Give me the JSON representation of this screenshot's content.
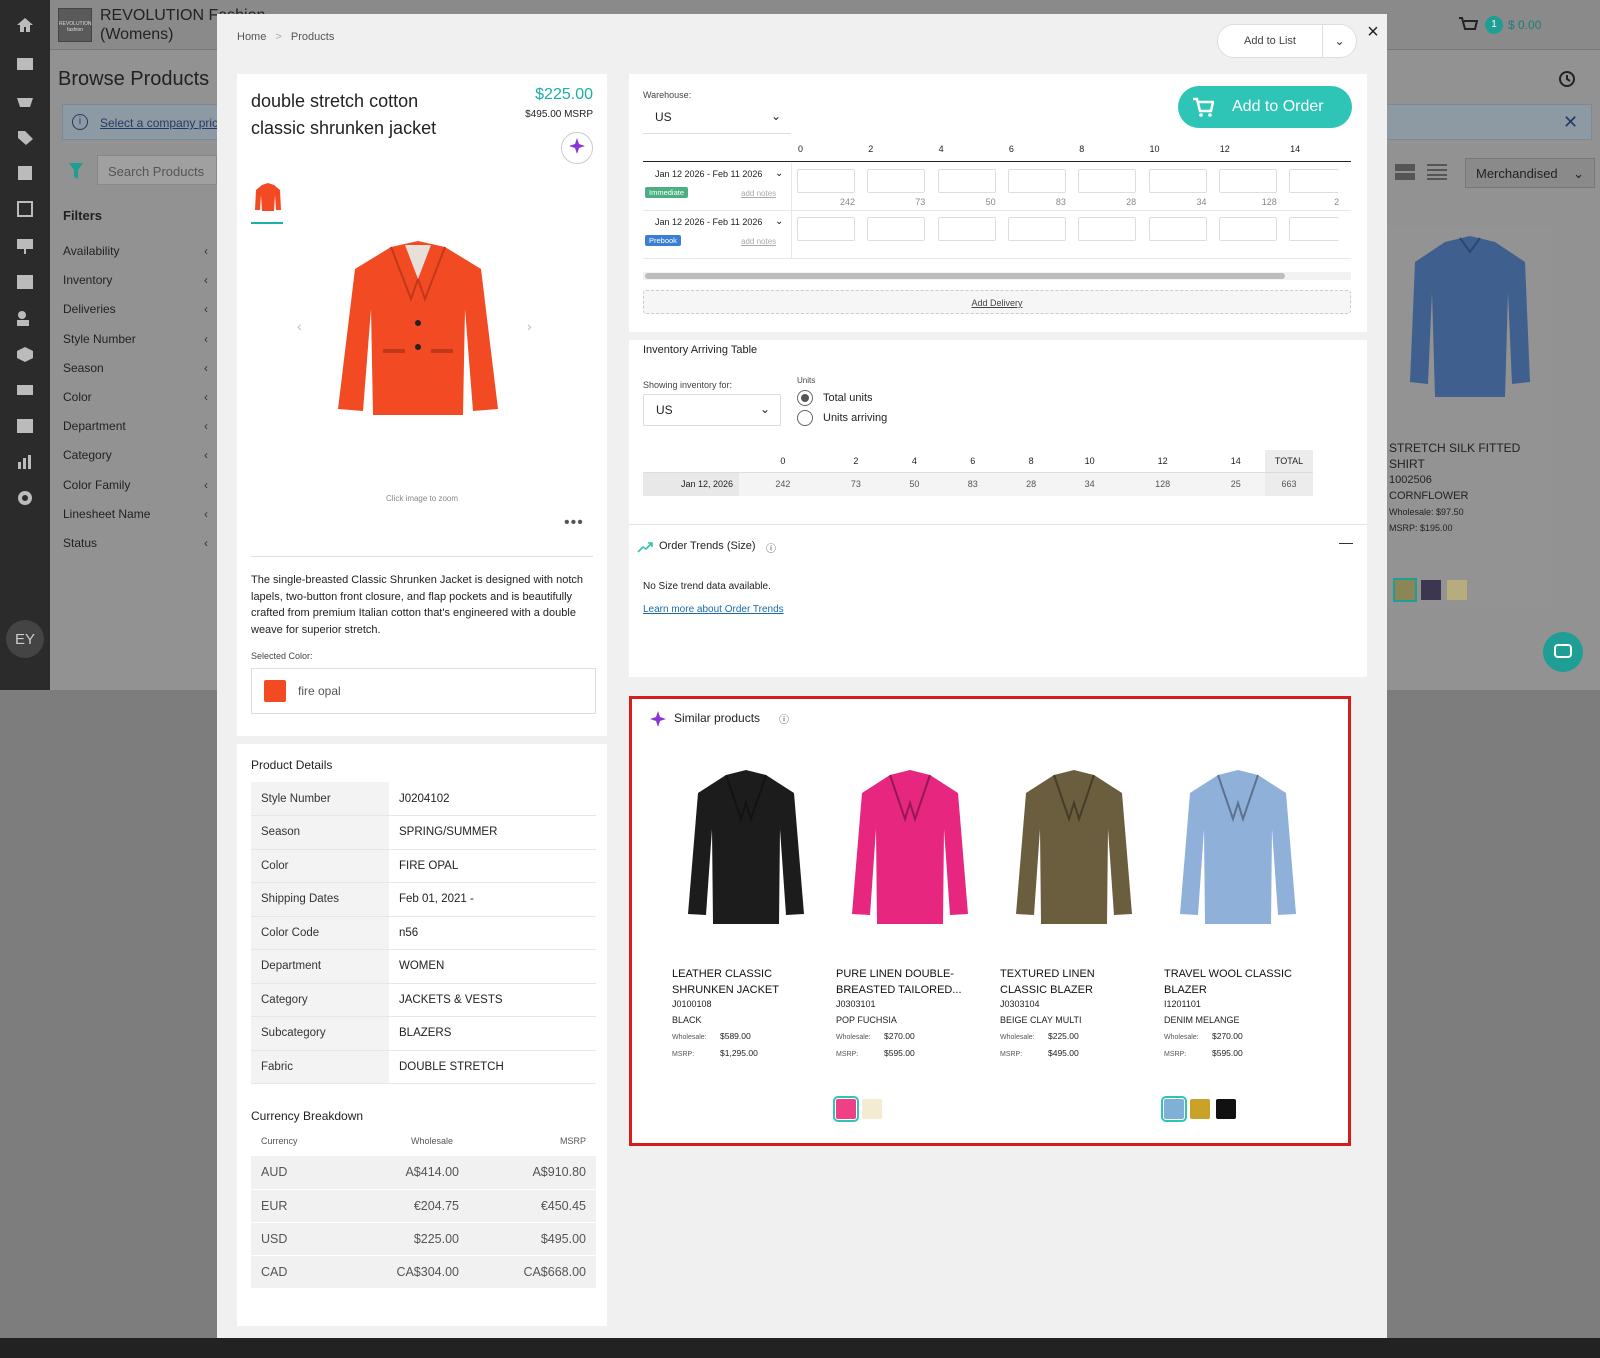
{
  "app": {
    "brand_line1": "REVOLUTION Fashion",
    "brand_line2": "(Womens)",
    "logo_text": "REVOLUTION fashion",
    "browse_title": "Browse Products",
    "company_link": "Select a company pricing",
    "search_placeholder": "Search Products",
    "filters_title": "Filters",
    "filters": [
      "Availability",
      "Inventory",
      "Deliveries",
      "Style Number",
      "Season",
      "Color",
      "Department",
      "Category",
      "Color Family",
      "Linesheet Name",
      "Status"
    ],
    "sort_label": "Merchandised",
    "cart_count": "1",
    "cart_total": "$ 0.00",
    "avatar_initials": "EY",
    "bg_card": {
      "name_line1": "STRETCH SILK FITTED",
      "name_line2": "SHIRT",
      "style": "1002506",
      "color": "CORNFLOWER",
      "wholesale_label": "Wholesale:",
      "wholesale": "$97.50",
      "msrp_label": "MSRP:",
      "msrp": "$195.00"
    }
  },
  "modal": {
    "breadcrumb": [
      "Home",
      "Products"
    ],
    "breadcrumb_sep": ">",
    "add_to_list": "Add to List",
    "close": "×",
    "product": {
      "title": "double stretch cotton classic shrunken jacket",
      "price": "$225.00",
      "msrp": "$495.00 MSRP",
      "zoom_hint": "Click image to zoom",
      "more": "•••",
      "description": "The single-breasted Classic Shrunken Jacket is designed with notch lapels, two-button front closure, and flap pockets and is beautifully crafted from premium Italian cotton that's engineered with a double weave for superior stretch.",
      "selected_color_label": "Selected Color:",
      "selected_color": "fire opal",
      "details_title": "Product Details",
      "details": [
        {
          "k": "Style Number",
          "v": "J0204102"
        },
        {
          "k": "Season",
          "v": "SPRING/SUMMER"
        },
        {
          "k": "Color",
          "v": "FIRE OPAL"
        },
        {
          "k": "Shipping Dates",
          "v": "Feb 01, 2021 -"
        },
        {
          "k": "Color Code",
          "v": "n56"
        },
        {
          "k": "Department",
          "v": "WOMEN"
        },
        {
          "k": "Category",
          "v": "JACKETS & VESTS"
        },
        {
          "k": "Subcategory",
          "v": "BLAZERS"
        },
        {
          "k": "Fabric",
          "v": "DOUBLE STRETCH"
        }
      ],
      "currency_title": "Currency Breakdown",
      "currency_headers": [
        "Currency",
        "Wholesale",
        "MSRP"
      ],
      "currencies": [
        {
          "c": "AUD",
          "w": "A$414.00",
          "m": "A$910.80"
        },
        {
          "c": "EUR",
          "w": "€204.75",
          "m": "€450.45"
        },
        {
          "c": "USD",
          "w": "$225.00",
          "m": "$495.00"
        },
        {
          "c": "CAD",
          "w": "CA$304.00",
          "m": "CA$668.00"
        }
      ]
    },
    "order": {
      "warehouse_label": "Warehouse:",
      "warehouse": "US",
      "add_to_order": "Add to Order",
      "sizes": [
        "0",
        "2",
        "4",
        "6",
        "8",
        "10",
        "12",
        "14"
      ],
      "deliveries": [
        {
          "date": "Jan 12 2026 - Feb 11 2026",
          "tag": "Immediate",
          "tag_color": "#4caf82",
          "notes": "add notes",
          "available": [
            "242",
            "73",
            "50",
            "83",
            "28",
            "34",
            "128",
            "2"
          ]
        },
        {
          "date": "Jan 12 2026 - Feb 11 2026",
          "tag": "Prebook",
          "tag_color": "#3b7fd4",
          "notes": "add notes",
          "available": []
        }
      ],
      "add_delivery": "Add Delivery"
    },
    "inventory": {
      "title": "Inventory Arriving Table",
      "showing_label": "Showing inventory for:",
      "showing_value": "US",
      "units_label": "Units",
      "units_options": [
        "Total units",
        "Units arriving"
      ],
      "units_selected": "Total units",
      "headers": [
        "0",
        "2",
        "4",
        "6",
        "8",
        "10",
        "12",
        "14",
        "TOTAL"
      ],
      "rows": [
        {
          "date": "Jan 12, 2026",
          "values": [
            "242",
            "73",
            "50",
            "83",
            "28",
            "34",
            "128",
            "25"
          ],
          "total": "663"
        }
      ]
    },
    "trends": {
      "title": "Order Trends (Size)",
      "info": "ⓘ",
      "collapse": "—",
      "empty": "No Size trend data available.",
      "link": "Learn more about Order Trends"
    },
    "similar": {
      "title": "Similar products",
      "info": "ⓘ",
      "items": [
        {
          "name1": "LEATHER CLASSIC",
          "name2": "SHRUNKEN JACKET",
          "style": "J0100108",
          "color": "BLACK",
          "ws_label": "Wholesale:",
          "ws": "$589.00",
          "msrp_label": "MSRP:",
          "msrp": "$1,295.00",
          "jacket_color": "#1c1c1c",
          "swatches": []
        },
        {
          "name1": "PURE LINEN DOUBLE-",
          "name2": "BREASTED TAILORED...",
          "style": "J0303101",
          "color": "POP FUCHSIA",
          "ws_label": "Wholesale:",
          "ws": "$270.00",
          "msrp_label": "MSRP:",
          "msrp": "$595.00",
          "jacket_color": "#e6267f",
          "swatches": [
            "#ef3f86",
            "#f3ecd2"
          ]
        },
        {
          "name1": "TEXTURED LINEN",
          "name2": "CLASSIC BLAZER",
          "style": "J0303104",
          "color": "BEIGE CLAY MULTI",
          "ws_label": "Wholesale:",
          "ws": "$225.00",
          "msrp_label": "MSRP:",
          "msrp": "$495.00",
          "jacket_color": "#6b5e3e",
          "swatches": []
        },
        {
          "name1": "TRAVEL WOOL CLASSIC",
          "name2": "BLAZER",
          "style": "I1201101",
          "color": "DENIM MELANGE",
          "ws_label": "Wholesale:",
          "ws": "$270.00",
          "msrp_label": "MSRP:",
          "msrp": "$595.00",
          "jacket_color": "#8fb0d8",
          "swatches": [
            "#7fb0d6",
            "#c9a227",
            "#111111"
          ]
        }
      ]
    }
  },
  "colors": {
    "accent": "#2ec4b6",
    "price": "#1ab0a3",
    "highlight_border": "#d61d1d",
    "product_swatch": "#f24a23"
  }
}
